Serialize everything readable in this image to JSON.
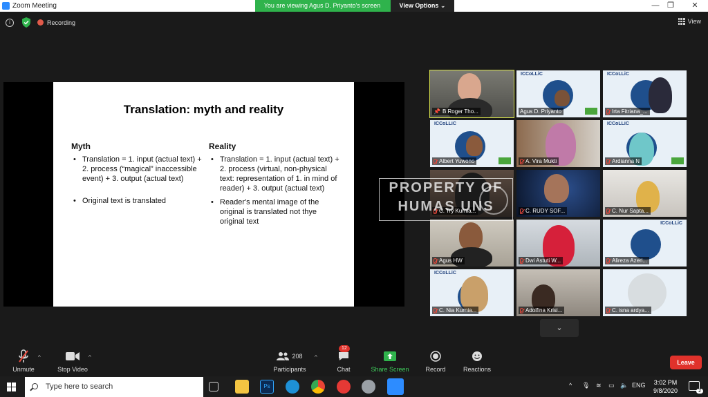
{
  "window": {
    "title": "Zoom Meeting"
  },
  "banner": {
    "viewing": "You are viewing Agus D. Priyanto's screen",
    "view_options": "View Options ⌄"
  },
  "topbar": {
    "recording": "Recording",
    "view": "View"
  },
  "slide": {
    "title": "Translation: myth and reality",
    "myth": {
      "heading": "Myth",
      "items": [
        "Translation = 1. input (actual text) + 2. process  (“magical” inaccessible event) + 3. output (actual text)",
        "Original text is translated"
      ]
    },
    "reality": {
      "heading": "Reality",
      "items": [
        "Translation = 1. input (actual text) + 2. process (virtual, non-physical text: representation of 1. in mind of reader) + 3. output (actual text)",
        "Reader's mental image of the original is translated not thye original text"
      ]
    }
  },
  "watermark": {
    "line1": "PROPERTY OF",
    "line2": "HUMAS UNS"
  },
  "participants": [
    {
      "name": "B Roger Tho...",
      "active": true,
      "pinned": true
    },
    {
      "name": "Agus D. Priyanto"
    },
    {
      "name": "Irta Fitriana_..."
    },
    {
      "name": "Albert Yuwono"
    },
    {
      "name": "A. Vira Mukti"
    },
    {
      "name": "Ardianna N"
    },
    {
      "name": "C. Try Kurnia..."
    },
    {
      "name": "C. RUDY SOF..."
    },
    {
      "name": "C. Nur Sapta..."
    },
    {
      "name": "Agus HW"
    },
    {
      "name": "Dwi Astuti W..."
    },
    {
      "name": "Alireza Azeri..."
    },
    {
      "name": "C. Nia Kurnia..."
    },
    {
      "name": "Adolfina Krisi..."
    },
    {
      "name": "C. isna ardya..."
    }
  ],
  "toolbar": {
    "unmute": "Unmute",
    "stop_video": "Stop Video",
    "participants_count": "208",
    "participants": "Participants",
    "chat_badge": "12",
    "chat": "Chat",
    "share_screen": "Share Screen",
    "record": "Record",
    "reactions": "Reactions",
    "leave": "Leave"
  },
  "taskbar": {
    "search_placeholder": "Type here to search",
    "lang": "ENG",
    "time": "3:02 PM",
    "date": "9/8/2020",
    "notifications": "2"
  },
  "colors": {
    "zoom_blue": "#2d8cff",
    "viewing_green": "#2fb34c",
    "leave_red": "#e0322b",
    "active_speaker": "#d8e34b"
  }
}
